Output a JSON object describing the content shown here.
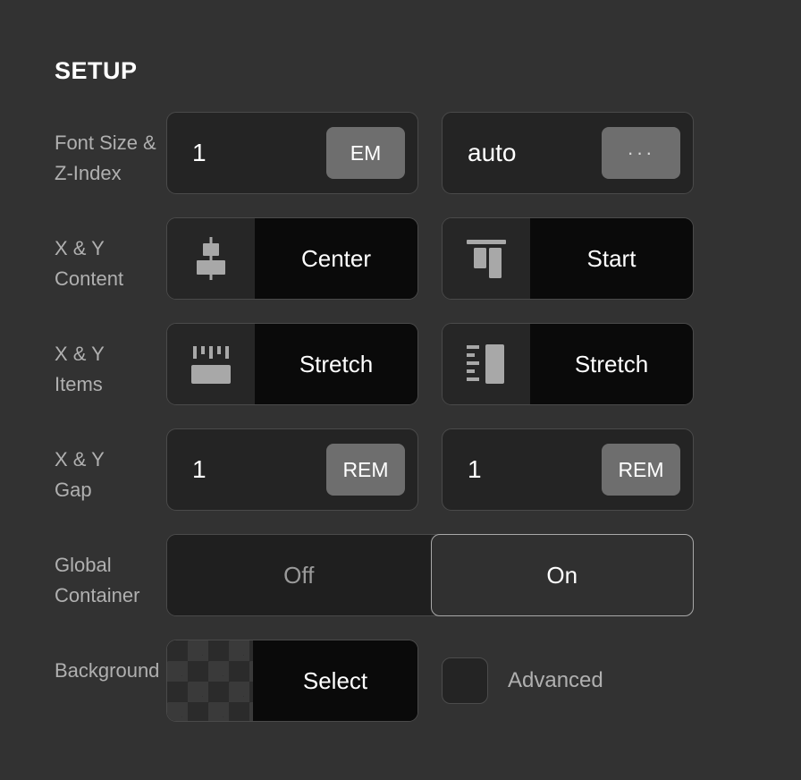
{
  "panel": {
    "title": "SETUP"
  },
  "rows": [
    {
      "label": "Font Size &\nZ-Index",
      "type": "numeric",
      "fields": [
        {
          "value": "1",
          "unit": "EM",
          "unit_icon": "unit-text"
        },
        {
          "value": "auto",
          "unit": "···",
          "unit_icon": "ellipsis-icon"
        }
      ]
    },
    {
      "label": "X & Y\nContent",
      "type": "icon-select",
      "fields": [
        {
          "icon": "align-center-vertical-icon",
          "value": "Center"
        },
        {
          "icon": "align-start-top-icon",
          "value": "Start"
        }
      ]
    },
    {
      "label": "X & Y\nItems",
      "type": "icon-select",
      "fields": [
        {
          "icon": "stretch-horizontal-icon",
          "value": "Stretch"
        },
        {
          "icon": "stretch-vertical-icon",
          "value": "Stretch"
        }
      ]
    },
    {
      "label": "X & Y\nGap",
      "type": "numeric",
      "fields": [
        {
          "value": "1",
          "unit": "REM",
          "unit_icon": "unit-text"
        },
        {
          "value": "1",
          "unit": "REM",
          "unit_icon": "unit-text"
        }
      ]
    },
    {
      "label": "Global\nContainer",
      "type": "segmented",
      "options": [
        {
          "label": "Off",
          "selected": false
        },
        {
          "label": "On",
          "selected": true
        }
      ]
    },
    {
      "label": "Background",
      "type": "swatch",
      "swatch": {
        "label": "Select",
        "pattern": "transparency-checker"
      },
      "checkbox": {
        "label": "Advanced",
        "checked": false
      }
    }
  ],
  "colors": {
    "page_background": "#323232",
    "control_background": "#242424",
    "control_border": "#4a4a4a",
    "text_pane_background": "#0a0a0a",
    "unit_chip": "#6e6e6e",
    "label_text": "#b0b0b0",
    "value_text": "#ffffff",
    "active_segment_border": "#a8a8a8"
  }
}
